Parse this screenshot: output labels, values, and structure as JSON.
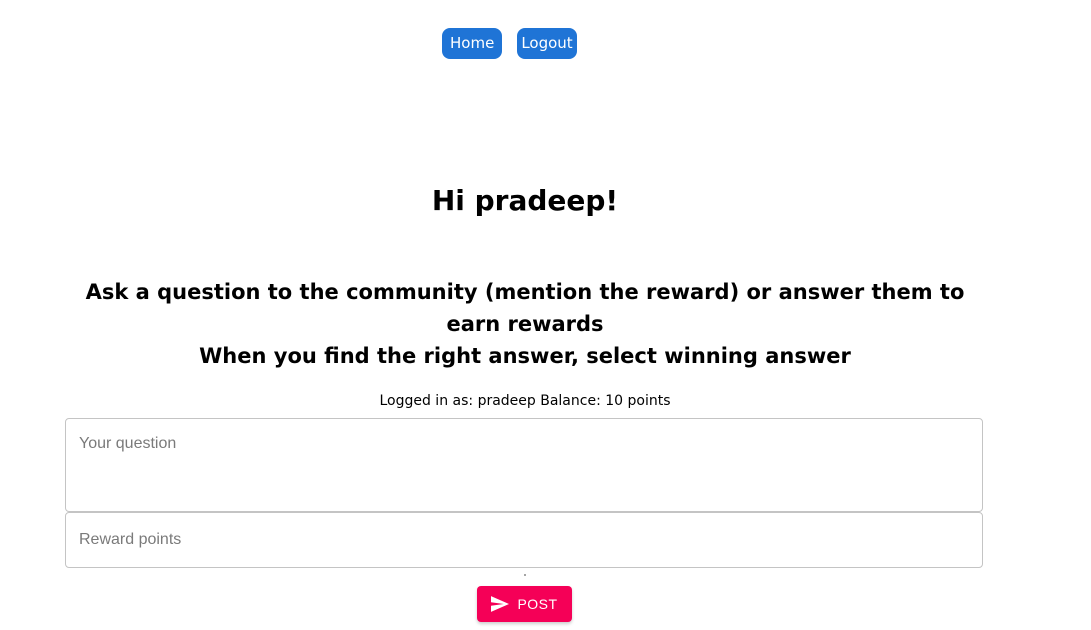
{
  "nav": {
    "home_label": "Home",
    "logout_label": "Logout",
    "button_color": "#1f74d6"
  },
  "greeting": "Hi pradeep!",
  "instructions": {
    "line1": "Ask a question to the community (mention the reward) or answer them to earn rewards",
    "line2": "When you find the right answer, select winning answer"
  },
  "status": {
    "text": "Logged in as: pradeep Balance: 10 points"
  },
  "form": {
    "question": {
      "value": "",
      "placeholder": "Your question"
    },
    "reward": {
      "value": "",
      "placeholder": "Reward points"
    },
    "post_label": "POST",
    "post_icon": "send-icon",
    "post_color": "#f50057"
  }
}
